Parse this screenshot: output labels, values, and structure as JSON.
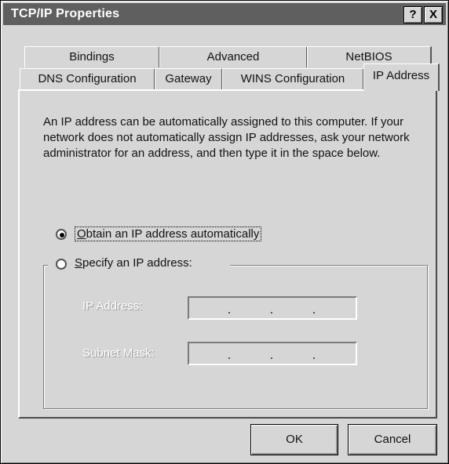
{
  "window": {
    "title": "TCP/IP Properties",
    "help_label": "?",
    "close_label": "X"
  },
  "tabs": {
    "row1": [
      "Bindings",
      "Advanced",
      "NetBIOS"
    ],
    "row2": [
      "DNS Configuration",
      "Gateway",
      "WINS Configuration"
    ],
    "active": "IP Address"
  },
  "panel": {
    "description": "An IP address can be automatically assigned to this computer. If your network does not automatically assign IP addresses, ask your network administrator for an address, and then type it in the space below.",
    "obtain_auto": {
      "accel": "O",
      "rest": "btain an IP address automatically",
      "selected": true
    },
    "specify": {
      "accel": "S",
      "rest": "pecify an IP address:",
      "selected": false
    },
    "ip_address_label": "IP Address:",
    "subnet_mask_label": "Subnet Mask:"
  },
  "buttons": {
    "ok": "OK",
    "cancel": "Cancel"
  },
  "colors": {
    "titlebar": "#5f5f5f",
    "face": "#d6d6d6"
  }
}
